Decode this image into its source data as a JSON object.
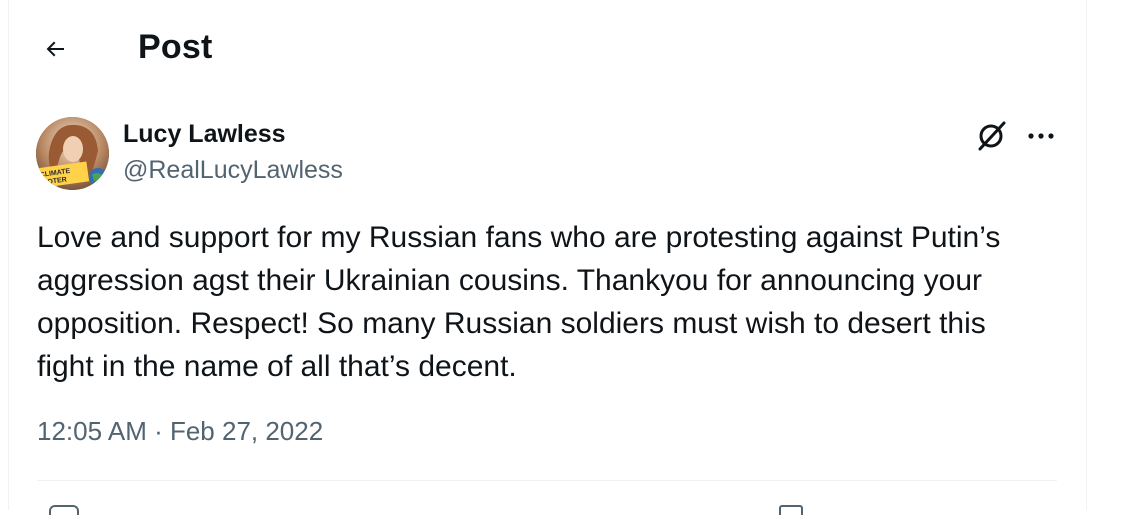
{
  "header": {
    "back_icon": "arrow-left-icon",
    "title": "Post"
  },
  "post": {
    "author": {
      "name": "Lucy Lawless",
      "handle": "@RealLucyLawless",
      "avatar_badge": "CLIMATE VOTER"
    },
    "grok_icon": "grok-icon",
    "more_icon": "more-options-icon",
    "text_lines": [
      "Love and support for my Russian fans who are protesting against Putin’s",
      "aggression agst their Ukrainian cousins. Thankyou for announcing your",
      "opposition. Respect! So many Russian soldiers must wish to desert this",
      "fight in the name of all that’s decent."
    ],
    "timestamp": "12:05 AM · Feb 27, 2022"
  },
  "colors": {
    "text_primary": "#0f1419",
    "text_secondary": "#536471",
    "divider": "#eff3f4",
    "background": "#ffffff"
  }
}
